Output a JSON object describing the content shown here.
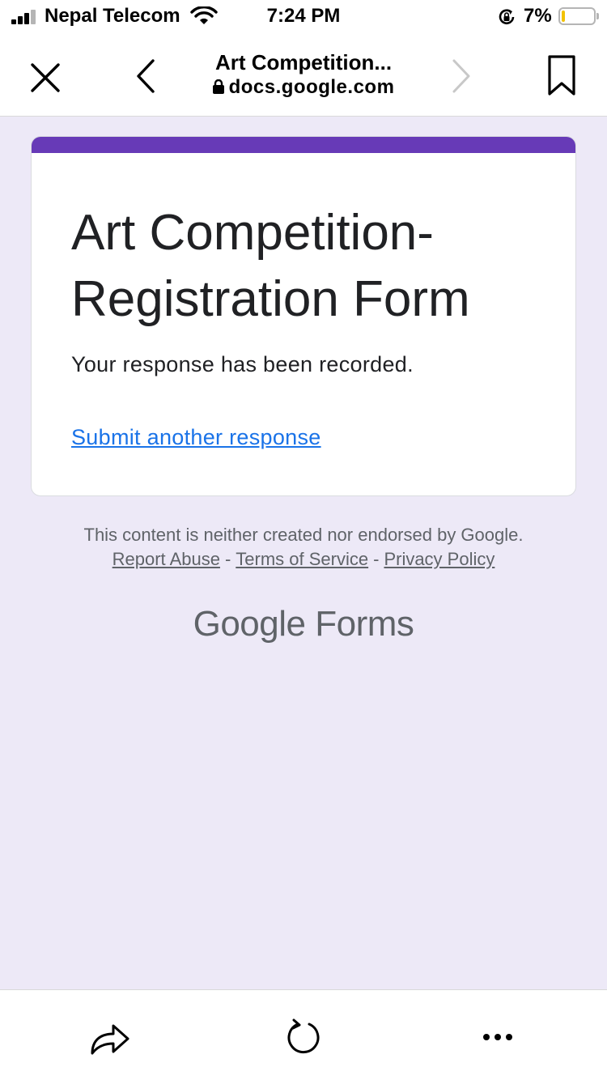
{
  "status_bar": {
    "carrier": "Nepal Telecom",
    "time": "7:24 PM",
    "battery": "7%",
    "battery_level": 0.07
  },
  "browser": {
    "page_title": "Art Competition...",
    "url": "docs.google.com",
    "icons": [
      "close-icon",
      "back-icon",
      "forward-icon",
      "bookmark-icon",
      "lock-icon"
    ]
  },
  "form": {
    "title": "Art Competition- Registration Form",
    "confirmation": "Your response has been recorded.",
    "submit_another": "Submit another response",
    "accent_color": "#673ab7",
    "link_color": "#1a73e8",
    "background_color": "#ede9f7"
  },
  "footer": {
    "disclaimer": "This content is neither created nor endorsed by Google.",
    "report_abuse": "Report Abuse",
    "separator": "-",
    "terms": "Terms of Service",
    "privacy": "Privacy Policy",
    "brand_google": "Google",
    "brand_forms": "Forms"
  },
  "toolbar": {
    "icons": [
      "share-icon",
      "reload-icon",
      "more-icon"
    ]
  }
}
